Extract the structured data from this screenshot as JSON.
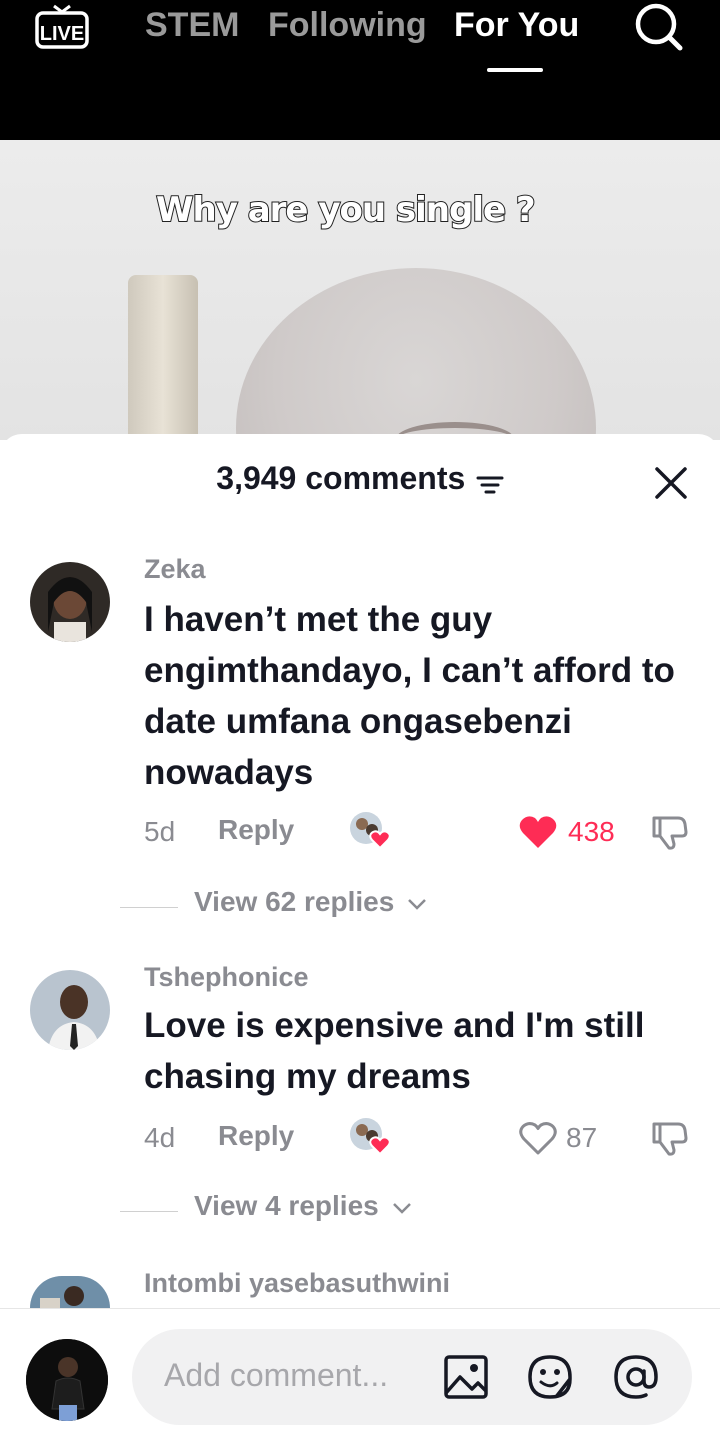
{
  "top_nav": {
    "live_label": "LIVE",
    "tabs": [
      {
        "label": "STEM",
        "active": false
      },
      {
        "label": "Following",
        "active": false
      },
      {
        "label": "For You",
        "active": true
      }
    ],
    "search_icon": "search-icon"
  },
  "video": {
    "caption": "Why are you single ?"
  },
  "comments_sheet": {
    "count_label": "3,949 comments",
    "sort_icon": "sort-icon",
    "close_icon": "close-icon",
    "comments": [
      {
        "username": "Zeka",
        "text": "I haven’t met the guy engimthandayo, I can’t afford to date umfana ongasebenzi nowadays",
        "age": "5d",
        "reply_label": "Reply",
        "likes": "438",
        "liked": true,
        "view_replies": "View 62 replies"
      },
      {
        "username": "Tshephonice",
        "text": "Love is expensive and I'm still chasing my dreams",
        "age": "4d",
        "reply_label": "Reply",
        "likes": "87",
        "liked": false,
        "view_replies": "View 4 replies"
      },
      {
        "username": "Intombi yasebasuthwini"
      }
    ]
  },
  "composer": {
    "placeholder": "Add comment...",
    "icons": [
      "image-icon",
      "emoji-icon",
      "mention-icon"
    ]
  },
  "colors": {
    "like_red": "#fe2c55",
    "text_primary": "#161823",
    "text_secondary": "#8a8b91"
  }
}
